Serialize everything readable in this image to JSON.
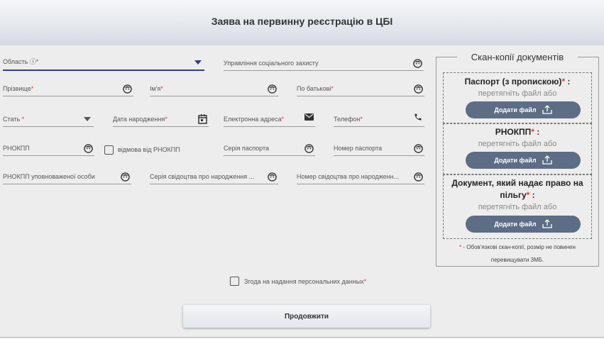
{
  "header": {
    "title": "Заява на первинну реєстрацію в ЦБІ"
  },
  "fields": {
    "oblast": {
      "label": "Область",
      "required": "*"
    },
    "social": {
      "label": "Управління соціального захисту"
    },
    "surname": {
      "label": "Прізвище",
      "required": "*"
    },
    "name": {
      "label": "Ім'я",
      "required": "*"
    },
    "patronymic": {
      "label": "По батькові",
      "required": "*"
    },
    "gender": {
      "label": "Стать",
      "required": " *"
    },
    "birthdate": {
      "label": "Дата народження",
      "required": "*"
    },
    "email": {
      "label": "Електронна адреса",
      "required": "*"
    },
    "phone": {
      "label": "Телефон",
      "required": "*"
    },
    "rnokpp": {
      "label": "РНОКПП"
    },
    "refuse_rnokpp": {
      "label": "відмова від РНОКПП"
    },
    "passport_series": {
      "label": "Серія паспорта"
    },
    "passport_number": {
      "label": "Номер паспорта"
    },
    "rnokpp_authorized": {
      "label": "РНОКПП уповноваженої особи"
    },
    "birth_cert_series": {
      "label": "Серія свідоцтва про народження ..."
    },
    "birth_cert_number": {
      "label": "Номер свідоцтва про народженн..."
    }
  },
  "consent": {
    "label": "Згода на надання персональних данных",
    "required": "*"
  },
  "continue_button": {
    "label": "Продовжити"
  },
  "documents": {
    "title": "Скан-копії документів",
    "hint": "перетягніть файл або",
    "add_label": "Додати файл",
    "passport": {
      "name": "Паспорт (з пропискою)",
      "required": "*",
      "suffix": " :"
    },
    "rnokpp": {
      "name": "РНОКПП",
      "required": "*",
      "suffix": " :"
    },
    "benefit": {
      "name": "Документ, який надає право на пільгу",
      "required": "*",
      "suffix": " :"
    },
    "note_star": "*",
    "note": " - Обов'язкові скан-копії, розмір не повинен перевищувати 3МБ."
  },
  "colors": {
    "accent": "#2c3f99",
    "required": "#e53935",
    "button": "#5e6d86"
  }
}
